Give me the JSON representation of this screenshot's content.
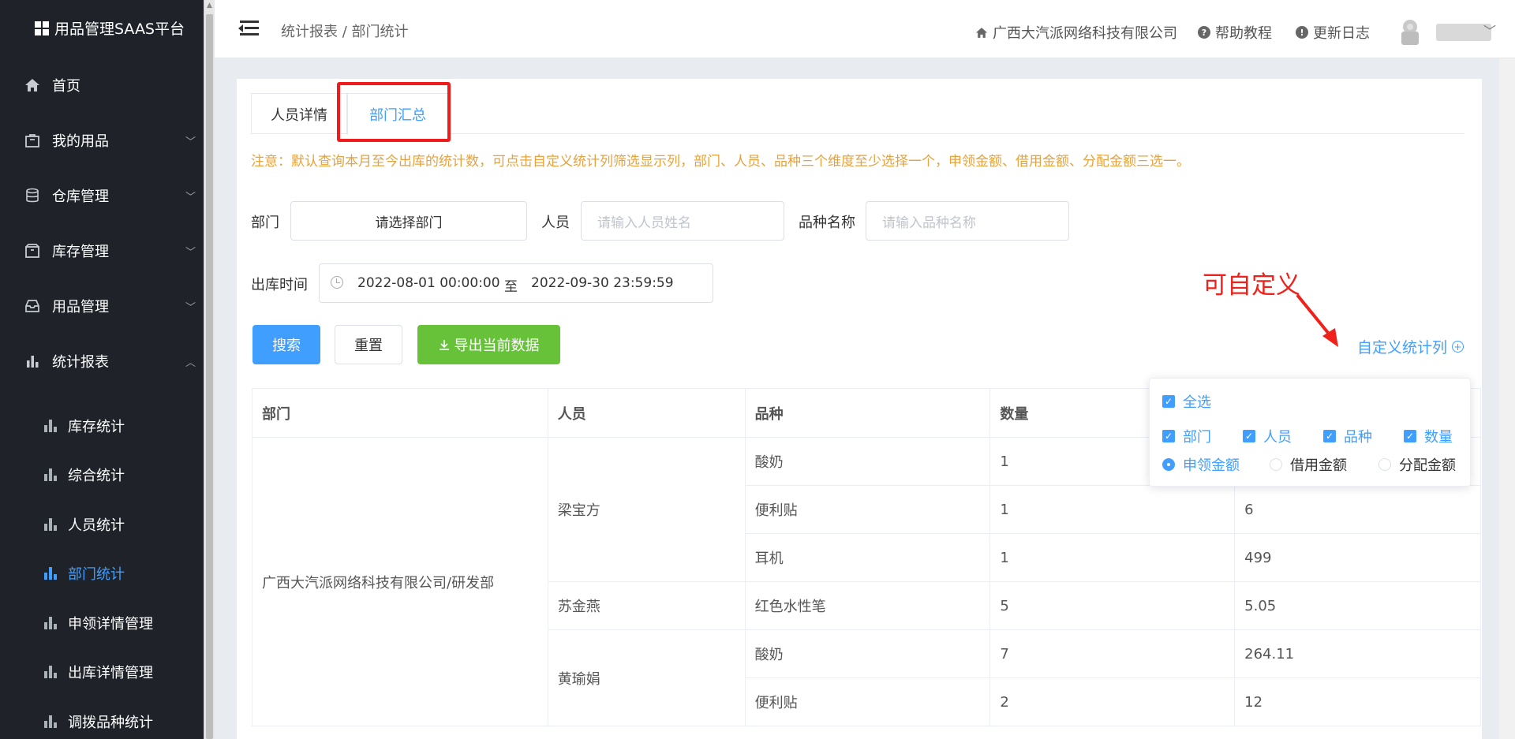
{
  "sidebar": {
    "logo": "用品管理SAAS平台",
    "menu": [
      {
        "label": "首页",
        "icon": "home-icon"
      },
      {
        "label": "我的用品",
        "icon": "bag-icon"
      },
      {
        "label": "仓库管理",
        "icon": "database-icon"
      },
      {
        "label": "库存管理",
        "icon": "box-icon"
      },
      {
        "label": "用品管理",
        "icon": "tray-icon"
      },
      {
        "label": "统计报表",
        "icon": "bar-chart-icon"
      }
    ],
    "submenu": [
      {
        "label": "库存统计"
      },
      {
        "label": "综合统计"
      },
      {
        "label": "人员统计"
      },
      {
        "label": "部门统计"
      },
      {
        "label": "申领详情管理"
      },
      {
        "label": "出库详情管理"
      },
      {
        "label": "调拨品种统计"
      }
    ]
  },
  "header": {
    "breadcrumb": "统计报表 / 部门统计",
    "company": "广西大汽派网络科技有限公司",
    "help": "帮助教程",
    "changelog": "更新日志"
  },
  "tabs": {
    "detail": "人员详情",
    "summary": "部门汇总"
  },
  "notice": "注意：默认查询本月至今出库的统计数，可点击自定义统计列筛选显示列，部门、人员、品种三个维度至少选择一个，申领金额、借用金额、分配金额三选一。",
  "filters": {
    "dept_label": "部门",
    "dept_value": "请选择部门",
    "person_label": "人员",
    "person_placeholder": "请输入人员姓名",
    "variety_label": "品种名称",
    "variety_placeholder": "请输入品种名称",
    "time_label": "出库时间",
    "date_start": "2022-08-01 00:00:00",
    "date_sep": "至",
    "date_end": "2022-09-30 23:59:59"
  },
  "buttons": {
    "search": "搜索",
    "reset": "重置",
    "export": "导出当前数据"
  },
  "custom_link": "自定义统计列",
  "annotation": "可自定义",
  "table": {
    "headers": [
      "部门",
      "人员",
      "品种",
      "数量",
      ""
    ],
    "dept": "广西大汽派网络科技有限公司/研发部",
    "persons": [
      "梁宝方",
      "苏金燕",
      "黄瑜娟"
    ],
    "rows": [
      {
        "variety": "酸奶",
        "qty": "1",
        "amount": ""
      },
      {
        "variety": "便利贴",
        "qty": "1",
        "amount": "6"
      },
      {
        "variety": "耳机",
        "qty": "1",
        "amount": "499"
      },
      {
        "variety": "红色水性笔",
        "qty": "5",
        "amount": "5.05"
      },
      {
        "variety": "酸奶",
        "qty": "7",
        "amount": "264.11"
      },
      {
        "variety": "便利贴",
        "qty": "2",
        "amount": "12"
      }
    ]
  },
  "popover": {
    "all": "全选",
    "dept": "部门",
    "person": "人员",
    "variety": "品种",
    "qty": "数量",
    "apply_amount": "申领金额",
    "borrow_amount": "借用金额",
    "alloc_amount": "分配金额"
  }
}
